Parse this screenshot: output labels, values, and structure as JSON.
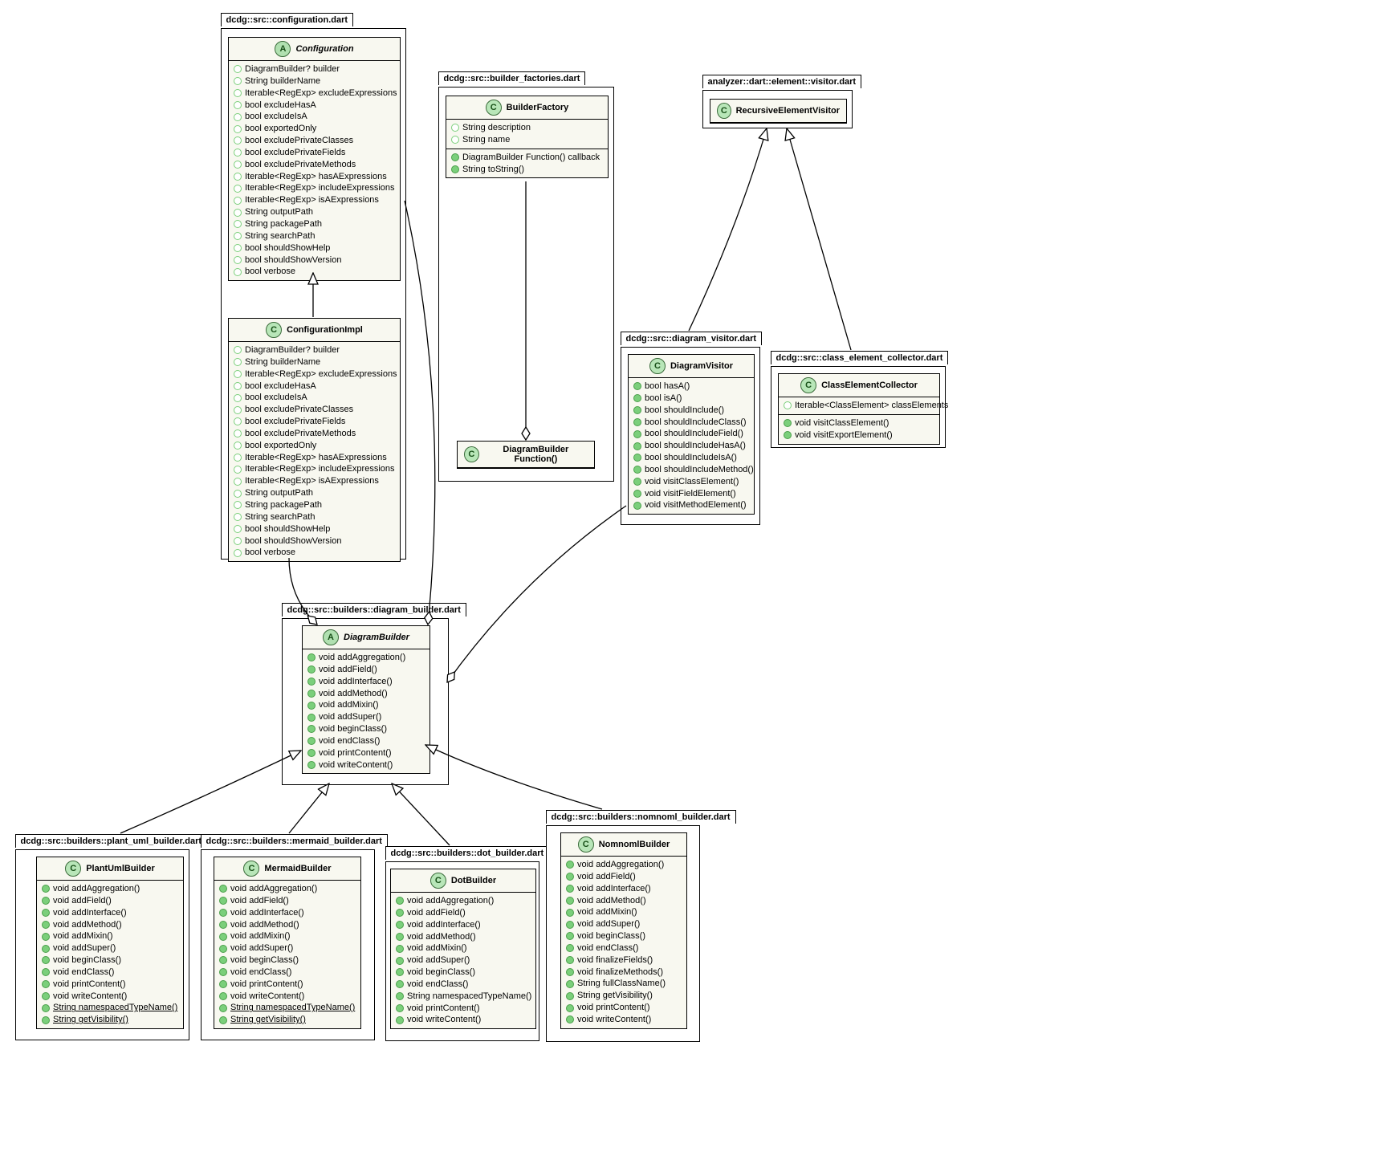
{
  "packages": {
    "configuration": {
      "label": "dcdg::src::configuration.dart",
      "classes": {
        "Configuration": {
          "name": "Configuration",
          "kind": "A",
          "fields": [
            "DiagramBuilder? builder",
            "String builderName",
            "Iterable<RegExp> excludeExpressions",
            "bool excludeHasA",
            "bool excludeIsA",
            "bool exportedOnly",
            "bool excludePrivateClasses",
            "bool excludePrivateFields",
            "bool excludePrivateMethods",
            "Iterable<RegExp> hasAExpressions",
            "Iterable<RegExp> includeExpressions",
            "Iterable<RegExp> isAExpressions",
            "String outputPath",
            "String packagePath",
            "String searchPath",
            "bool shouldShowHelp",
            "bool shouldShowVersion",
            "bool verbose"
          ]
        },
        "ConfigurationImpl": {
          "name": "ConfigurationImpl",
          "kind": "C",
          "fields": [
            "DiagramBuilder? builder",
            "String builderName",
            "Iterable<RegExp> excludeExpressions",
            "bool excludeHasA",
            "bool excludeIsA",
            "bool excludePrivateClasses",
            "bool excludePrivateFields",
            "bool excludePrivateMethods",
            "bool exportedOnly",
            "Iterable<RegExp> hasAExpressions",
            "Iterable<RegExp> includeExpressions",
            "Iterable<RegExp> isAExpressions",
            "String outputPath",
            "String packagePath",
            "String searchPath",
            "bool shouldShowHelp",
            "bool shouldShowVersion",
            "bool verbose"
          ]
        }
      }
    },
    "builder_factories": {
      "label": "dcdg::src::builder_factories.dart",
      "classes": {
        "BuilderFactory": {
          "name": "BuilderFactory",
          "kind": "C",
          "fields": [
            "String description",
            "String name"
          ],
          "methods": [
            "DiagramBuilder Function() callback",
            "String toString()"
          ]
        },
        "DiagramBuilderFunction": {
          "name": "DiagramBuilder Function()",
          "kind": "C"
        }
      }
    },
    "diagram_visitor": {
      "label": "dcdg::src::diagram_visitor.dart",
      "classes": {
        "DiagramVisitor": {
          "name": "DiagramVisitor",
          "kind": "C",
          "methods": [
            "bool hasA()",
            "bool isA()",
            "bool shouldInclude()",
            "bool shouldIncludeClass()",
            "bool shouldIncludeField()",
            "bool shouldIncludeHasA()",
            "bool shouldIncludeIsA()",
            "bool shouldIncludeMethod()",
            "void visitClassElement()",
            "void visitFieldElement()",
            "void visitMethodElement()"
          ]
        }
      }
    },
    "analyzer_visitor": {
      "label": "analyzer::dart::element::visitor.dart",
      "classes": {
        "RecursiveElementVisitor": {
          "name": "RecursiveElementVisitor",
          "kind": "C"
        }
      }
    },
    "class_element_collector": {
      "label": "dcdg::src::class_element_collector.dart",
      "classes": {
        "ClassElementCollector": {
          "name": "ClassElementCollector",
          "kind": "C",
          "fields": [
            "Iterable<ClassElement> classElements"
          ],
          "methods": [
            "void visitClassElement()",
            "void visitExportElement()"
          ]
        }
      }
    },
    "diagram_builder": {
      "label": "dcdg::src::builders::diagram_builder.dart",
      "classes": {
        "DiagramBuilder": {
          "name": "DiagramBuilder",
          "kind": "A",
          "methods": [
            "void addAggregation()",
            "void addField()",
            "void addInterface()",
            "void addMethod()",
            "void addMixin()",
            "void addSuper()",
            "void beginClass()",
            "void endClass()",
            "void printContent()",
            "void writeContent()"
          ]
        }
      }
    },
    "plant_uml": {
      "label": "dcdg::src::builders::plant_uml_builder.dart",
      "classes": {
        "PlantUmlBuilder": {
          "name": "PlantUmlBuilder",
          "kind": "C",
          "methods": [
            "void addAggregation()",
            "void addField()",
            "void addInterface()",
            "void addMethod()",
            "void addMixin()",
            "void addSuper()",
            "void beginClass()",
            "void endClass()",
            "void printContent()",
            "void writeContent()"
          ],
          "static_methods": [
            "String namespacedTypeName()",
            "String getVisibility()"
          ]
        }
      }
    },
    "mermaid": {
      "label": "dcdg::src::builders::mermaid_builder.dart",
      "classes": {
        "MermaidBuilder": {
          "name": "MermaidBuilder",
          "kind": "C",
          "methods": [
            "void addAggregation()",
            "void addField()",
            "void addInterface()",
            "void addMethod()",
            "void addMixin()",
            "void addSuper()",
            "void beginClass()",
            "void endClass()",
            "void printContent()",
            "void writeContent()"
          ],
          "static_methods": [
            "String namespacedTypeName()",
            "String getVisibility()"
          ]
        }
      }
    },
    "dot": {
      "label": "dcdg::src::builders::dot_builder.dart",
      "classes": {
        "DotBuilder": {
          "name": "DotBuilder",
          "kind": "C",
          "methods": [
            "void addAggregation()",
            "void addField()",
            "void addInterface()",
            "void addMethod()",
            "void addMixin()",
            "void addSuper()",
            "void beginClass()",
            "void endClass()",
            "String namespacedTypeName()",
            "void printContent()",
            "void writeContent()"
          ]
        }
      }
    },
    "nomnoml": {
      "label": "dcdg::src::builders::nomnoml_builder.dart",
      "classes": {
        "NomnomlBuilder": {
          "name": "NomnomlBuilder",
          "kind": "C",
          "methods": [
            "void addAggregation()",
            "void addField()",
            "void addInterface()",
            "void addMethod()",
            "void addMixin()",
            "void addSuper()",
            "void beginClass()",
            "void endClass()",
            "void finalizeFields()",
            "void finalizeMethods()",
            "String fullClassName()",
            "String getVisibility()",
            "void printContent()",
            "void writeContent()"
          ]
        }
      }
    }
  },
  "vis": {
    "public_hollow": "○",
    "public": "●"
  }
}
